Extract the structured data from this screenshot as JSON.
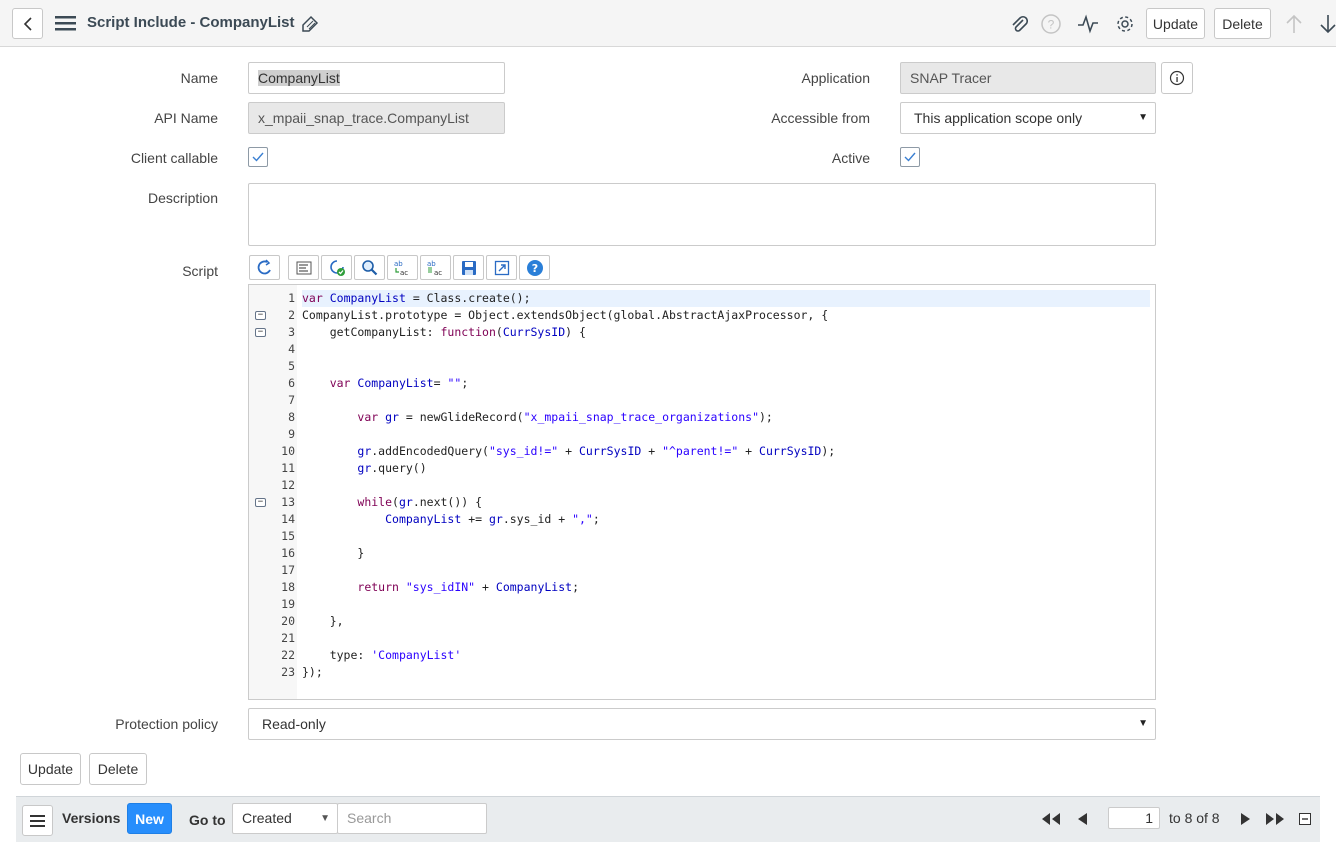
{
  "header": {
    "title": "Script Include - CompanyList",
    "update_label": "Update",
    "delete_label": "Delete"
  },
  "form": {
    "name_label": "Name",
    "name_value": "CompanyList",
    "api_name_label": "API Name",
    "api_name_value": "x_mpaii_snap_trace.CompanyList",
    "client_callable_label": "Client callable",
    "client_callable_checked": true,
    "description_label": "Description",
    "description_value": "",
    "script_label": "Script",
    "application_label": "Application",
    "application_value": "SNAP Tracer",
    "accessible_from_label": "Accessible from",
    "accessible_from_value": "This application scope only",
    "active_label": "Active",
    "active_checked": true,
    "protection_policy_label": "Protection policy",
    "protection_policy_value": "Read-only"
  },
  "toolbar_icons": [
    "toggle-syntax-icon",
    "format-code-icon",
    "script-debug-icon",
    "search-icon",
    "replace-icon",
    "replace-all-icon",
    "save-icon",
    "fullscreen-icon",
    "help-icon"
  ],
  "script_lines": [
    "var CompanyList = Class.create();",
    "CompanyList.prototype = Object.extendsObject(global.AbstractAjaxProcessor, {",
    "    getCompanyList: function(CurrSysID) {",
    "",
    "",
    "    var CompanyList= \"\";",
    "",
    "        var gr = newGlideRecord(\"x_mpaii_snap_trace_organizations\");",
    "",
    "        gr.addEncodedQuery(\"sys_id!=\" + CurrSysID + \"^parent!=\" + CurrSysID);",
    "        gr.query()",
    "",
    "        while(gr.next()) {",
    "            CompanyList += gr.sys_id + \",\";",
    "",
    "        }",
    "",
    "        return \"sys_idIN\" + CompanyList;",
    "",
    "    },",
    "",
    "    type: 'CompanyList'",
    "});"
  ],
  "fold_lines": [
    2,
    3,
    13
  ],
  "footer_buttons": {
    "update_label": "Update",
    "delete_label": "Delete"
  },
  "related_list": {
    "title": "Versions",
    "new_label": "New",
    "goto_label": "Go to",
    "goto_select": "Created",
    "search_placeholder": "Search",
    "page_value": "1",
    "page_total": "to 8 of 8"
  },
  "colors": {
    "header_bg": "#f5f5f5",
    "new_button": "#278efc",
    "readonly_bg": "#e8e8e8",
    "related_bg": "#e9ecee"
  }
}
